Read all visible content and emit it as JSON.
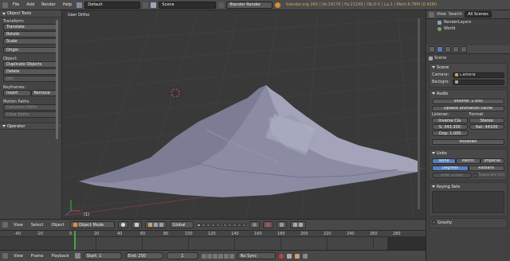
{
  "topbar": {
    "menus": [
      "File",
      "Add",
      "Render",
      "Help"
    ],
    "screen_layout": "Default",
    "scene": "Scene",
    "render_engine": "Blender Render",
    "info": "blender.org 260 | Ve:14176 | Fa:21249 | Ob:0-5 | La:1 | Mem:6.78M (0.42M)"
  },
  "toolshelf": {
    "title": "Object Tools",
    "transform_label": "Transform:",
    "translate": "Translate",
    "rotate": "Rotate",
    "scale": "Scale",
    "origin": "Origin",
    "object_label": "Object:",
    "duplicate": "Duplicate Objects",
    "delete": "Delete",
    "join": "Join",
    "keyframes_label": "Keyframes:",
    "insert": "Insert",
    "remove": "Remove",
    "motion_label": "Motion Paths:",
    "calc_paths": "Calculate Paths",
    "clear_paths": "Clear Paths",
    "operator_title": "Operator"
  },
  "viewport": {
    "label": "User Ortho",
    "frame_label": "(1)"
  },
  "view3d_header": {
    "menus": [
      "View",
      "Select",
      "Object"
    ],
    "mode": "Object Mode",
    "orientation": "Global"
  },
  "timeline": {
    "ticks": [
      "-40",
      "-20",
      "0",
      "20",
      "40",
      "60",
      "80",
      "100",
      "120",
      "140",
      "160",
      "180",
      "200",
      "220",
      "240",
      "260",
      "280"
    ],
    "menus": [
      "View",
      "Frame",
      "Playback"
    ],
    "start": "Start: 1",
    "end": "End: 250",
    "current": "1",
    "sync": "No Sync"
  },
  "outliner": {
    "menus": [
      "View",
      "Search"
    ],
    "filter": "All Scenes",
    "items": [
      "RenderLayers",
      "World"
    ]
  },
  "properties": {
    "context": "Scene",
    "scene_panel": "Scene",
    "camera_label": "Camera:",
    "camera_value": "Camera",
    "background_label": "Backgro:",
    "audio_panel": "Audio",
    "volume": "Volume: 1.000",
    "update_cache": "Update animation cache",
    "listener_label": "Listener:",
    "format_label": "Format:",
    "distance_model": "Inverse Cla",
    "channels": "Stereo",
    "speed": "S: 343.300",
    "rate": "Rat: 44100",
    "doppler": "Dop: 1.000",
    "mixdown": "Mixdown",
    "units_panel": "Units",
    "none": "None",
    "metric": "Metric",
    "imperial": "Imperial",
    "degrees": "Degrees",
    "radians": "Radians",
    "scale": "Scal: 1.000",
    "separate_units": "Separate Uni",
    "keying_sets_panel": "Keying Sets",
    "gravity_panel": "Gravity"
  }
}
